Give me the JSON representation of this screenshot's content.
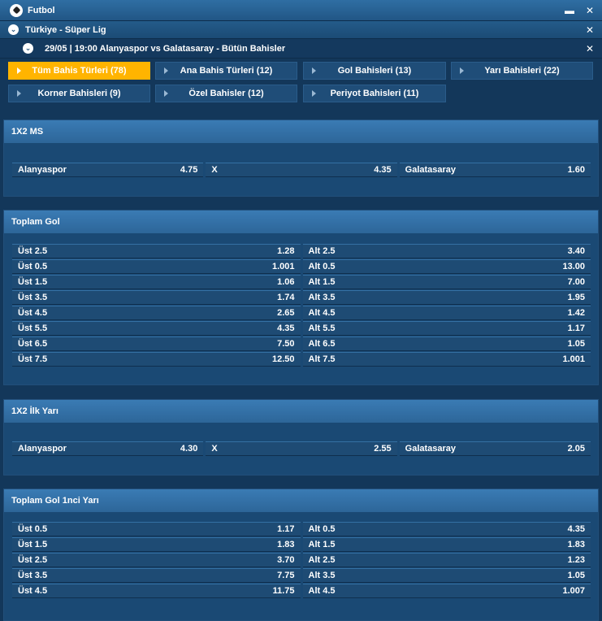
{
  "header": {
    "sport": "Futbol",
    "league": "Türkiye - Süper Lig",
    "match": "29/05 | 19:00 Alanyaspor vs Galatasaray - Bütün Bahisler"
  },
  "tabs": [
    {
      "label": "Tüm Bahis Türleri (78)",
      "active": true
    },
    {
      "label": "Ana Bahis Türleri (12)",
      "active": false
    },
    {
      "label": "Gol Bahisleri (13)",
      "active": false
    },
    {
      "label": "Yarı Bahisleri (22)",
      "active": false
    },
    {
      "label": "Korner Bahisleri (9)",
      "active": false
    },
    {
      "label": "Özel Bahisler (12)",
      "active": false
    },
    {
      "label": "Periyot Bahisleri (11)",
      "active": false
    }
  ],
  "sections": {
    "ms": {
      "title": "1X2 MS",
      "odds": [
        {
          "label": "Alanyaspor",
          "value": "4.75"
        },
        {
          "label": "X",
          "value": "4.35"
        },
        {
          "label": "Galatasaray",
          "value": "1.60"
        }
      ]
    },
    "total": {
      "title": "Toplam Gol",
      "rows": [
        {
          "over": "Üst 2.5",
          "over_odd": "1.28",
          "under": "Alt 2.5",
          "under_odd": "3.40"
        },
        {
          "over": "Üst 0.5",
          "over_odd": "1.001",
          "under": "Alt 0.5",
          "under_odd": "13.00"
        },
        {
          "over": "Üst 1.5",
          "over_odd": "1.06",
          "under": "Alt 1.5",
          "under_odd": "7.00"
        },
        {
          "over": "Üst 3.5",
          "over_odd": "1.74",
          "under": "Alt 3.5",
          "under_odd": "1.95"
        },
        {
          "over": "Üst 4.5",
          "over_odd": "2.65",
          "under": "Alt 4.5",
          "under_odd": "1.42"
        },
        {
          "over": "Üst 5.5",
          "over_odd": "4.35",
          "under": "Alt 5.5",
          "under_odd": "1.17"
        },
        {
          "over": "Üst 6.5",
          "over_odd": "7.50",
          "under": "Alt 6.5",
          "under_odd": "1.05"
        },
        {
          "over": "Üst 7.5",
          "over_odd": "12.50",
          "under": "Alt 7.5",
          "under_odd": "1.001"
        }
      ]
    },
    "ht": {
      "title": "1X2 İlk Yarı",
      "odds": [
        {
          "label": "Alanyaspor",
          "value": "4.30"
        },
        {
          "label": "X",
          "value": "2.55"
        },
        {
          "label": "Galatasaray",
          "value": "2.05"
        }
      ]
    },
    "ht_total": {
      "title": "Toplam Gol 1nci Yarı",
      "rows": [
        {
          "over": "Üst 0.5",
          "over_odd": "1.17",
          "under": "Alt 0.5",
          "under_odd": "4.35"
        },
        {
          "over": "Üst 1.5",
          "over_odd": "1.83",
          "under": "Alt 1.5",
          "under_odd": "1.83"
        },
        {
          "over": "Üst 2.5",
          "over_odd": "3.70",
          "under": "Alt 2.5",
          "under_odd": "1.23"
        },
        {
          "over": "Üst 3.5",
          "over_odd": "7.75",
          "under": "Alt 3.5",
          "under_odd": "1.05"
        },
        {
          "over": "Üst 4.5",
          "over_odd": "11.75",
          "under": "Alt 4.5",
          "under_odd": "1.007"
        }
      ]
    }
  },
  "icons": {
    "minimize": "minimize-icon",
    "close": "close-icon",
    "collapse": "chevron-down-icon",
    "sport": "soccer-ball-icon",
    "tab_arrow": "triangle-right-icon"
  },
  "colors": {
    "active_tab": "#ffb400",
    "header": "#2f6ea3",
    "background": "#13375a"
  }
}
